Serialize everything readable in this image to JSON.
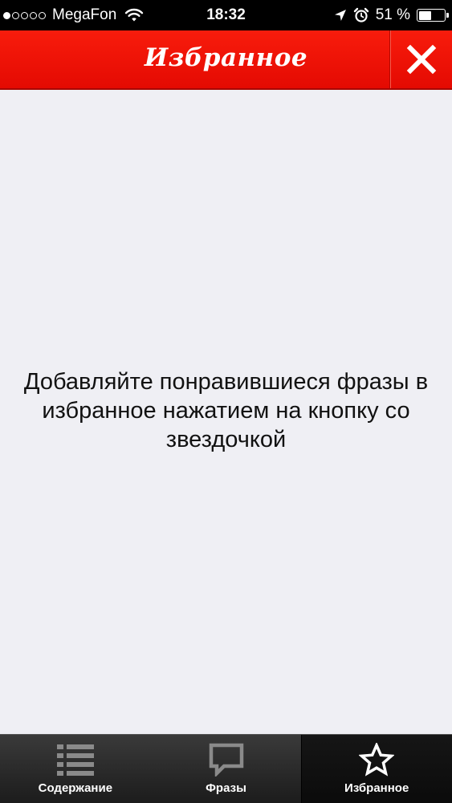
{
  "status_bar": {
    "signal_icon": "signal-dots-icon",
    "carrier": "MegaFon",
    "wifi_icon": "wifi-icon",
    "time": "18:32",
    "location_icon": "location-arrow-icon",
    "alarm_icon": "alarm-clock-icon",
    "battery_percent": "51 %",
    "battery_level": 0.51
  },
  "header": {
    "title": "Избранное",
    "close_icon": "close-icon",
    "background_color": "#f0140a"
  },
  "main": {
    "empty_message": "Добавляйте понравившиеся фразы в избранное нажатием на кнопку со звездочкой"
  },
  "tab_bar": {
    "tabs": [
      {
        "label": "Содержание",
        "icon": "list-icon",
        "active": false
      },
      {
        "label": "Фразы",
        "icon": "speech-bubble-icon",
        "active": false
      },
      {
        "label": "Избранное",
        "icon": "star-icon",
        "active": true
      }
    ]
  }
}
